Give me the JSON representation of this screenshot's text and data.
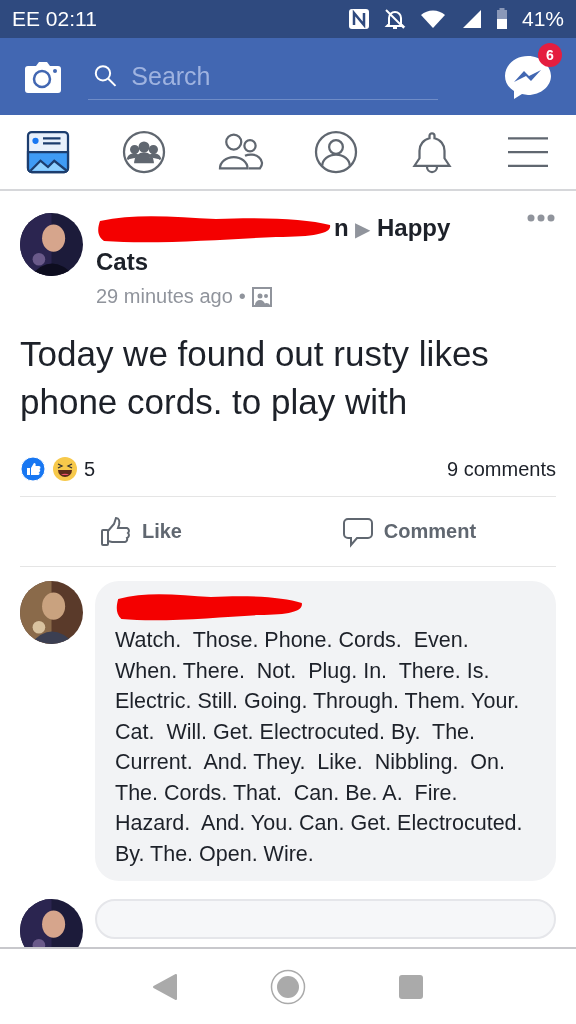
{
  "status_bar": {
    "carrier_time": "EE 02:11",
    "battery": "41%"
  },
  "header": {
    "search": {
      "placeholder": "Search"
    },
    "messenger_badge": "6"
  },
  "tabs": [
    {
      "kind": "feed",
      "selected": true
    },
    {
      "kind": "groups",
      "selected": false
    },
    {
      "kind": "friends",
      "selected": false
    },
    {
      "kind": "profile",
      "selected": false
    },
    {
      "kind": "notifications",
      "selected": false
    },
    {
      "kind": "menu",
      "selected": false
    }
  ],
  "post": {
    "author_visible": "n",
    "arrow": "▶",
    "group": "Happy Cats",
    "time": "29 minutes ago",
    "dot": "•",
    "text": "Today we found out rusty likes phone cords. to play with",
    "reaction_count": "5",
    "comments_count": "9 comments",
    "actions": [
      {
        "kind": "like",
        "label": "Like"
      },
      {
        "kind": "comment",
        "label": "Comment"
      }
    ]
  },
  "comments": [
    {
      "text": "Watch.  Those. Phone. Cords.  Even. When. There.  Not.  Plug. In.  There. Is.  Electric. Still. Going. Through. Them. Your.  Cat.  Will. Get. Electrocuted. By.  The.  Current.  And. They.  Like.  Nibbling.  On. The. Cords. That.  Can. Be. A.  Fire. Hazard.  And. You. Can. Get. Electrocuted. By. The. Open. Wire."
    }
  ]
}
